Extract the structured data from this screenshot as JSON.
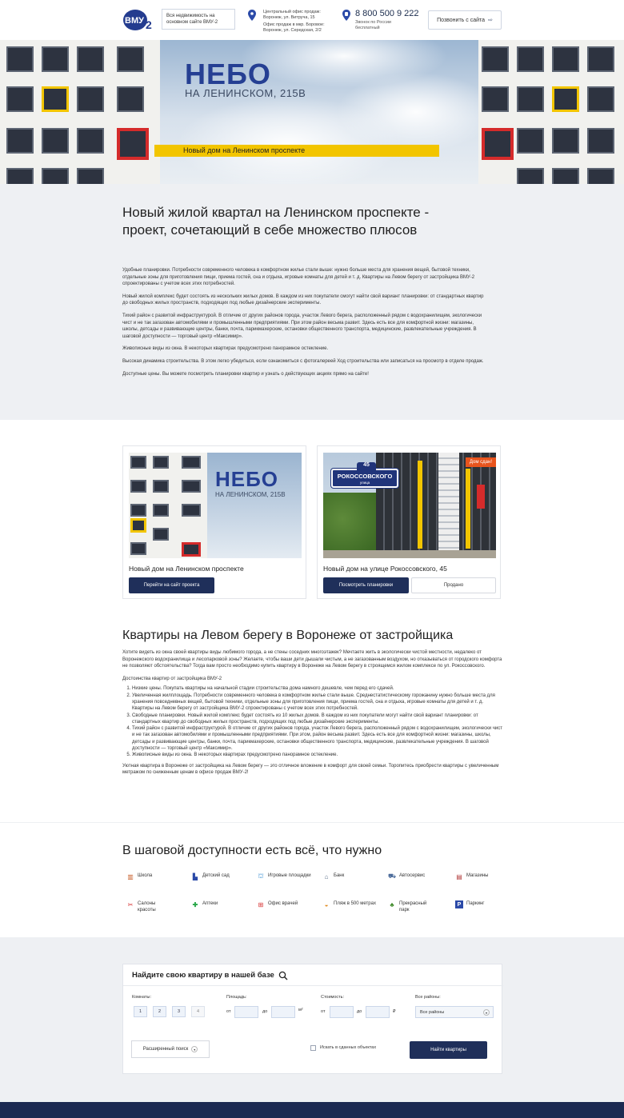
{
  "header": {
    "logo_text": "ВМУ-2",
    "logo_note": "Вся недвижимость на основном сайте ВМУ-2",
    "office_lines": [
      "Центральный офис продаж:",
      "Воронеж, ул. Витруча, 15",
      "Офис продаж в мкр. Боровое:",
      "Воронеж, ул. Середская, 2/2"
    ],
    "phone": "8 800 500 9 222",
    "phone_note_1": "Звонок по России",
    "phone_note_2": "бесплатный",
    "call_button": "Позвонить с сайта"
  },
  "hero": {
    "logo": "НЕБО",
    "subtitle": "НА ЛЕНИНСКОМ, 215В",
    "band_text": "Новый дом на Ленинском проспекте"
  },
  "intro": {
    "title": "Новый жилой квартал на Ленинском проспекте - проект, сочетающий в себе множество плюсов",
    "paragraphs": [
      "Удобные планировки. Потребности современного человека в комфортном жилье стали выше: нужно больше места для хранения вещей, бытовой техники, отдельные зоны для приготовления пищи, приема гостей, сна и отдыха, игровые комнаты для детей и т. д. Квартиры на Левом берегу от застройщика ВМУ-2 спроектированы с учетом всех этих потребностей.",
      "Новый жилой комплекс будет состоять из нескольких жилых домов. В каждом из них покупатели смогут найти свой вариант планировки: от стандартных квартир до свободных жилых пространств, подходящих под любые дизайнерские эксперименты.",
      "Тихий район с развитой инфраструктурой. В отличие от других районов города, участок Левого берега, расположенный рядом с водохранилищем, экологически чист и не так загазован автомобилями и промышленными предприятиями. При этом район весьма развит. Здесь есть все для комфортной жизни: магазины, школы, детсады и развивающие центры, банки, почта, парикмахерские, остановки общественного транспорта, медицинские, развлекательные учреждения. В шаговой доступности — торговый центр «Максимир».",
      "Живописные виды из окна. В некоторых квартирах предусмотрено панорамное остекление.",
      "Высокая динамика строительства. В этом легко убедиться, если ознакомиться с фотогалереей Ход строительства или записаться на просмотр в отделе продаж.",
      "Доступные цены. Вы можете посмотреть планировки квартир и узнать о действующих акциях прямо на сайте!"
    ]
  },
  "cards": [
    {
      "logo": "НЕБО",
      "subtitle": "НА ЛЕНИНСКОМ, 215В",
      "title": "Новый дом на Ленинском проспекте",
      "button": "Перейти на сайт проекта"
    },
    {
      "badge": "Дом сдан!",
      "sign_number": "45",
      "sign_street": "РОКОССОВСКОГО",
      "sign_type": "улица",
      "title": "Новый дом на улице Рокоссовского, 45",
      "button": "Посмотреть планировки",
      "button2": "Продано"
    }
  ],
  "article": {
    "title": "Квартиры на Левом берегу в Воронеже от застройщика",
    "lead": "Хотите видеть из окна своей квартиры виды любимого города, а не стены соседних многоэтажек? Мечтаете жить в экологически чистой местности, недалеко от Воронежского водохранилища и лесопарковой зоны? Желаете, чтобы ваши дети дышали чистым, а не загазованным воздухом, но отказываться от городского комфорта не позволяют обстоятельства? Тогда вам просто необходимо купить квартиру в Воронеже на Левом берегу в строящемся жилом комплексе по ул. Рокоссовского.",
    "list_title": "Достоинства квартир от застройщика ВМУ-2",
    "items": [
      "Низкие цены. Покупать квартиры на начальной стадии строительства дома намного дешевле, чем перед его сдачей.",
      "Увеличенная жилплощадь. Потребности современного человека в комфортном жилье стали выше. Среднестатистическому горожанину нужно больше места для хранения повседневных вещей, бытовой техники, отдельные зоны для приготовления пищи, приема гостей, сна и отдыха, игровые комнаты для детей и т. д. Квартиры на Левом берегу от застройщика ВМУ-2 спроектированы с учетом всех этих потребностей.",
      "Свободные планировки. Новый жилой комплекс будет состоять из 10 жилых домов. В каждом из них покупатели могут найти свой вариант планировки: от стандартных квартир до свободных жилых пространств, подходящих под любые дизайнерские эксперименты.",
      "Тихий район с развитой инфраструктурой. В отличие от других районов города, участок Левого берега, расположенный рядом с водохранилищем, экологически чист и не так загазован автомобилями и промышленными предприятиями. При этом, район весьма развит. Здесь есть все для комфортной жизни: магазины, школы, детсады и развивающие центры, банки, почта, парикмахерские, остановки общественного транспорта, медицинские, развлекательные учреждения. В шаговой доступности — торговый центр «Максимир».",
      "Живописные виды из окна. В некоторых квартирах предусмотрено панорамное остекление."
    ],
    "closing": "Уютная квартира в Воронеже от застройщика на Левом берегу — это отличное вложение в комфорт для своей семьи. Торопитесь приобрести квартиры с увеличенным метражом по сниженным ценам в офисе продаж ВМУ-2!"
  },
  "amenities": {
    "title": "В шаговой доступности есть всё, что нужно",
    "items": [
      {
        "label": "Школа",
        "icon": "school-icon"
      },
      {
        "label": "Детский сад",
        "icon": "kindergarten-icon"
      },
      {
        "label": "Игровые площадки",
        "icon": "playground-icon"
      },
      {
        "label": "Банк",
        "icon": "bank-icon"
      },
      {
        "label": "Автосервис",
        "icon": "car-service-icon"
      },
      {
        "label": "Магазины",
        "icon": "shop-icon"
      },
      {
        "label": "Салоны красоты",
        "icon": "beauty-salon-icon"
      },
      {
        "label": "Аптеки",
        "icon": "pharmacy-icon"
      },
      {
        "label": "Офис врачей",
        "icon": "doctor-icon"
      },
      {
        "label": "Пляж в 500 метрах",
        "icon": "beach-icon"
      },
      {
        "label": "Прекрасный парк",
        "icon": "park-icon"
      },
      {
        "label": "Паркинг",
        "icon": "parking-icon"
      }
    ]
  },
  "search": {
    "title": "Найдите свою квартиру в нашей базе",
    "rooms_label": "Комнаты:",
    "rooms": [
      "1",
      "2",
      "3",
      "4"
    ],
    "area_label": "Площадь:",
    "area_from": "от",
    "area_to": "до",
    "area_unit": "м²",
    "price_label": "Стоимость:",
    "price_from": "от",
    "price_to": "до",
    "price_unit": "₽",
    "district_label": "Все районы:",
    "district_value": "Все районы",
    "advanced_button": "Расширенный поиск",
    "checkbox_label": "Искать в сданных объектах",
    "find_button": "Найти квартиры"
  },
  "colors": {
    "brand_blue": "#253f93",
    "dark_button": "#1f2f5a",
    "accent_yellow": "#f2c500",
    "accent_red": "#d52b2b",
    "footer": "#1c2a52"
  }
}
